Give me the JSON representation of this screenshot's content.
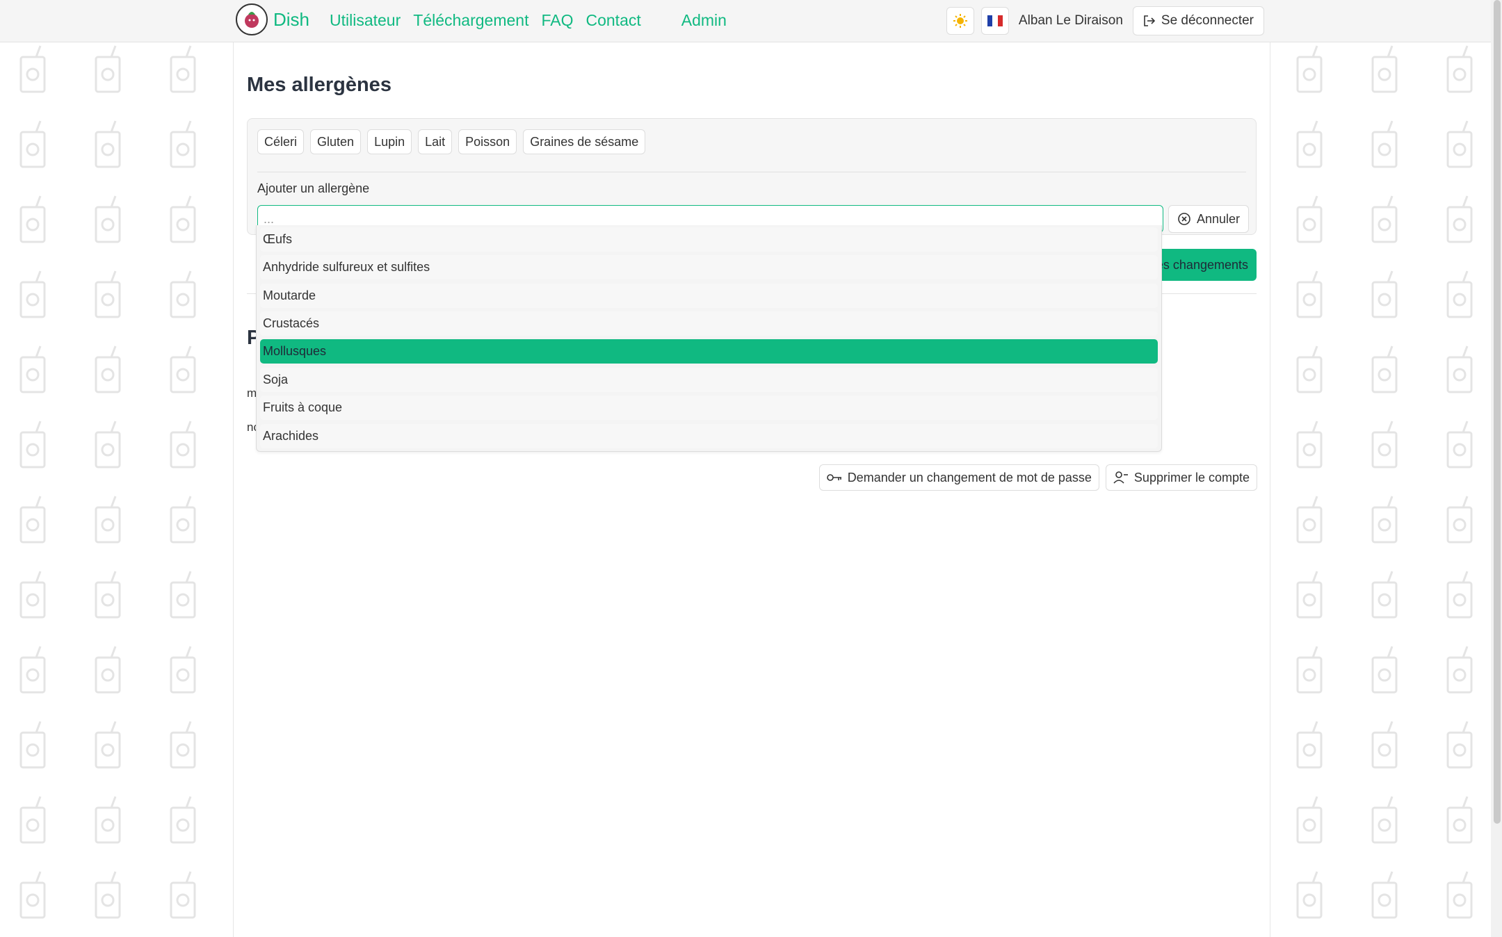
{
  "app": {
    "brand": "Dish"
  },
  "nav": {
    "links": [
      "Utilisateur",
      "Téléchargement",
      "FAQ",
      "Contact",
      "Admin"
    ],
    "user_name": "Alban Le Diraison",
    "logout_label": "Se déconnecter",
    "theme_icon": "sun-icon",
    "language_icon": "french-flag-icon"
  },
  "allergens": {
    "title": "Mes allergènes",
    "chips": [
      "Céleri",
      "Gluten",
      "Lupin",
      "Lait",
      "Poisson",
      "Graines de sésame"
    ],
    "add_label": "Ajouter un allergène",
    "search_placeholder": "...",
    "cancel_label": "Annuler",
    "save_label": "es changements",
    "dropdown": {
      "options": [
        "Œufs",
        "Anhydride sulfureux et sulfites",
        "Moutarde",
        "Crustacés",
        "Mollusques",
        "Soja",
        "Fruits à coque",
        "Arachides"
      ],
      "highlighted": "Mollusques"
    }
  },
  "profile": {
    "title_partial": "P",
    "field1_partial": "m",
    "field2_partial": "nc"
  },
  "actions": {
    "password_label": "Demander un changement de mot de passe",
    "delete_label": "Supprimer le compte"
  },
  "colors": {
    "accent": "#10b981",
    "text": "#2b3340"
  }
}
